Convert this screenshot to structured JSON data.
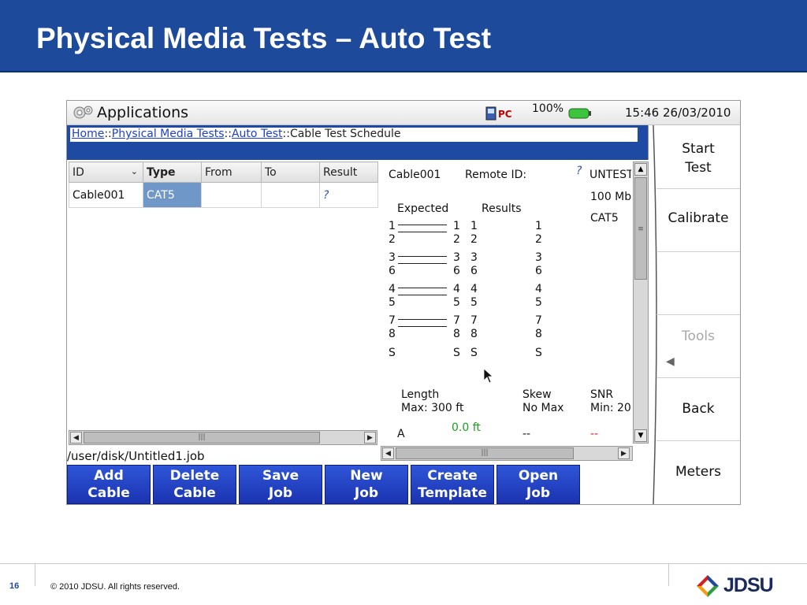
{
  "slide": {
    "title": "Physical Media Tests – Auto Test",
    "page_number": "16",
    "copyright": "© 2010 JDSU. All rights reserved.",
    "logo_text": "JDSU"
  },
  "device": {
    "app_title": "Applications",
    "battery": "100%",
    "clock": "15:46  26/03/2010",
    "breadcrumb": {
      "home": "Home",
      "sep1": "::",
      "physical": "Physical Media Tests",
      "sep2": "::",
      "auto": "Auto Test",
      "rest": "::Cable Test Schedule"
    },
    "table": {
      "headers": [
        "ID",
        "Type",
        "From",
        "To",
        "Result"
      ],
      "rows": [
        {
          "id": "Cable001",
          "type": "CAT5",
          "from": "",
          "to": "",
          "result": "?"
        }
      ]
    },
    "path": "/user/disk/Untitled1.job",
    "detail": {
      "cable": "Cable001",
      "remote_label": "Remote ID:",
      "remote_value": "?",
      "status": "UNTEST",
      "speed": "100 Mb",
      "cat": "CAT5",
      "expected_label": "Expected",
      "results_label": "Results",
      "pairs": [
        {
          "e1": "1",
          "e2": "2",
          "r1": "1",
          "r2": "2",
          "m1": "1",
          "m2": "2",
          "s1": "1",
          "s2": "2"
        },
        {
          "e1": "3",
          "e2": "6",
          "r1": "3",
          "r2": "6",
          "m1": "3",
          "m2": "6",
          "s1": "3",
          "s2": "6"
        },
        {
          "e1": "4",
          "e2": "5",
          "r1": "4",
          "r2": "5",
          "m1": "4",
          "m2": "5",
          "s1": "4",
          "s2": "5"
        },
        {
          "e1": "7",
          "e2": "8",
          "r1": "7",
          "r2": "8",
          "m1": "7",
          "m2": "8",
          "s1": "7",
          "s2": "8"
        }
      ],
      "shield": {
        "e": "S",
        "r": "S",
        "m": "S",
        "s": "S"
      },
      "length_label": "Length",
      "length_max": "Max: 300 ft",
      "skew_label": "Skew",
      "skew_max": "No Max",
      "snr_label": "SNR",
      "snr_min": "Min: 20",
      "row_a": "A",
      "length_val": "0.0 ft",
      "skew_val": "--",
      "snr_val": "--"
    },
    "buttons": [
      {
        "line1": "Add",
        "line2": "Cable"
      },
      {
        "line1": "Delete",
        "line2": "Cable"
      },
      {
        "line1": "Save",
        "line2": "Job"
      },
      {
        "line1": "New",
        "line2": "Job"
      },
      {
        "line1": "Create",
        "line2": "Template"
      },
      {
        "line1": "Open",
        "line2": "Job"
      }
    ],
    "side": {
      "start_1": "Start",
      "start_2": "Test",
      "calibrate": "Calibrate",
      "tools": "Tools",
      "back": "Back",
      "meters": "Meters"
    },
    "colors": {
      "header_blue": "#1d4a9b",
      "button_blue": "#1b33b0",
      "selected_cell": "#6f97c7",
      "ok_green": "#1aa01a",
      "error_red": "#d42020"
    }
  }
}
